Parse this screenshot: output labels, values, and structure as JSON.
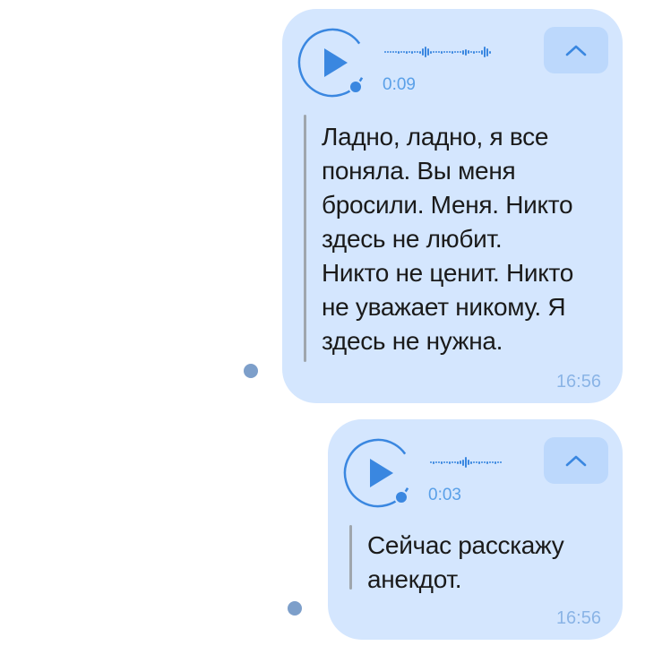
{
  "messages": [
    {
      "duration": "0:09",
      "transcript_lines": [
        "Ладно, ладно, я все",
        "поняла. Вы меня",
        "бросили. Меня. Никто",
        "здесь не любит.",
        "Никто не ценит. Никто",
        "не уважает никому. Я",
        "здесь не нужна."
      ],
      "time": "16:56"
    },
    {
      "duration": "0:03",
      "transcript_lines": [
        "Сейчас расскажу",
        "анекдот."
      ],
      "time": "16:56"
    }
  ],
  "icons": {
    "play": "play-icon",
    "collapse": "chevron-up-icon"
  },
  "colors": {
    "bubble": "#d4e6fe",
    "accent": "#3a87e0",
    "collapse_button": "#bcd8fc",
    "quote_bar": "#9fa6ad",
    "time_text": "#8ab4e6",
    "status_dot": "#7d9fca"
  }
}
